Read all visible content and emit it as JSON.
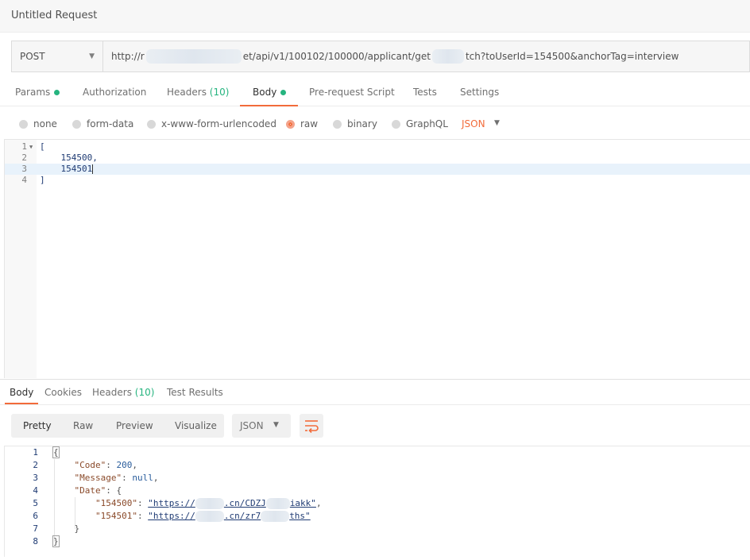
{
  "header": {
    "title": "Untitled Request"
  },
  "request": {
    "method": "POST",
    "url_start": "http://r",
    "url_mid": "et/api/v1/100102/100000/applicant/get",
    "url_end": "tch?toUserId=154500&anchorTag=interview"
  },
  "req_tabs": {
    "params": "Params",
    "authorization": "Authorization",
    "headers": "Headers",
    "headers_count": "(10)",
    "body": "Body",
    "prerequest": "Pre-request Script",
    "tests": "Tests",
    "settings": "Settings"
  },
  "body_types": {
    "none": "none",
    "form_data": "form-data",
    "urlencoded": "x-www-form-urlencoded",
    "raw": "raw",
    "binary": "binary",
    "graphql": "GraphQL",
    "format": "JSON",
    "selected": "raw"
  },
  "editor": {
    "lines": [
      {
        "n": "1",
        "text": "["
      },
      {
        "n": "2",
        "text": "    154500,"
      },
      {
        "n": "3",
        "text": "    154501"
      },
      {
        "n": "4",
        "text": "]"
      }
    ]
  },
  "resp_tabs": {
    "body": "Body",
    "cookies": "Cookies",
    "headers": "Headers",
    "headers_count": "(10)",
    "test_results": "Test Results"
  },
  "view": {
    "pretty": "Pretty",
    "raw": "Raw",
    "preview": "Preview",
    "visualize": "Visualize",
    "format": "JSON"
  },
  "response": {
    "line_numbers": [
      "1",
      "2",
      "3",
      "4",
      "5",
      "6",
      "7",
      "8"
    ],
    "open_brace": "{",
    "code_key": "\"Code\"",
    "code_val": "200",
    "message_key": "\"Message\"",
    "message_val": "null",
    "date_key": "\"Date\"",
    "date_open": "{",
    "k1": "\"154500\"",
    "v1_start": "\"https://",
    "v1_end": ".cn/CDZJ",
    "v1_tail": "iakk\"",
    "k2": "\"154501\"",
    "v2_start": "\"https://",
    "v2_end": ".cn/zr7",
    "v2_tail": "ths\"",
    "date_close": "}",
    "close_brace": "}"
  }
}
